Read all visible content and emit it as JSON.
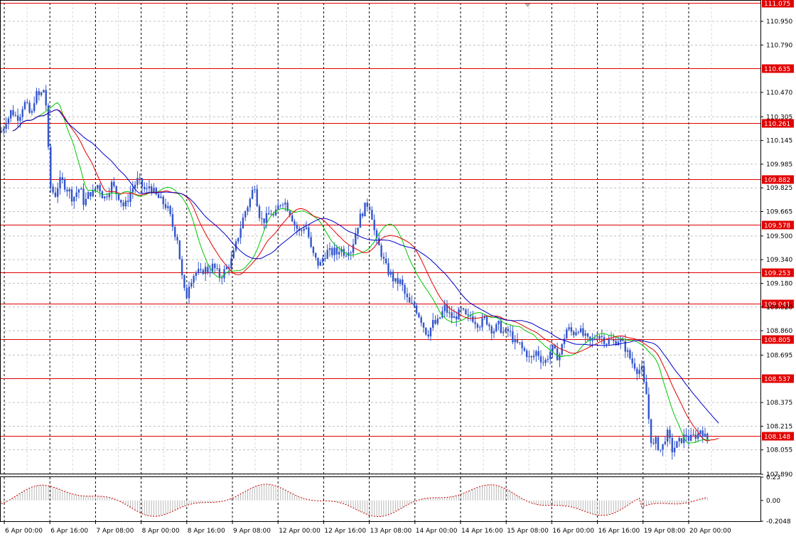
{
  "chart_data": {
    "type": "candlestick",
    "instrument_hint": "",
    "price_axis_ticks": [
      "110.950",
      "110.790",
      "110.470",
      "110.305",
      "110.145",
      "109.985",
      "109.825",
      "109.665",
      "109.500",
      "109.340",
      "109.180",
      "109.020",
      "108.860",
      "108.695",
      "108.375",
      "108.215",
      "108.055",
      "107.890"
    ],
    "price_ylim": [
      107.89,
      111.075
    ],
    "resistance_levels": [
      111.075,
      110.635,
      110.261,
      109.882,
      109.578,
      109.253,
      109.041,
      108.805,
      108.537,
      108.148
    ],
    "resistance_labels": [
      "111.075",
      "110.635",
      "110.261",
      "109.882",
      "109.578",
      "109.253",
      "109.041",
      "108.805",
      "108.537",
      "108.148"
    ],
    "time_axis_labels": [
      "6 Apr 00:00",
      "6 Apr 16:00",
      "7 Apr 08:00",
      "8 Apr 00:00",
      "8 Apr 16:00",
      "9 Apr 08:00",
      "12 Apr 00:00",
      "12 Apr 16:00",
      "13 Apr 08:00",
      "14 Apr 00:00",
      "14 Apr 16:00",
      "15 Apr 08:00",
      "16 Apr 00:00",
      "16 Apr 16:00",
      "19 Apr 08:00",
      "20 Apr 00:00"
    ],
    "price_path": [
      [
        0,
        110.2
      ],
      [
        4,
        110.22
      ],
      [
        8,
        110.28
      ],
      [
        12,
        110.3
      ],
      [
        16,
        110.35
      ],
      [
        20,
        110.32
      ],
      [
        24,
        110.3
      ],
      [
        28,
        110.32
      ],
      [
        32,
        110.38
      ],
      [
        36,
        110.4
      ],
      [
        40,
        110.35
      ],
      [
        44,
        110.3
      ],
      [
        48,
        110.42
      ],
      [
        52,
        110.46
      ],
      [
        56,
        110.44
      ],
      [
        60,
        110.48
      ],
      [
        63,
        110.5
      ],
      [
        66,
        110.3
      ],
      [
        70,
        109.85
      ],
      [
        74,
        109.8
      ],
      [
        78,
        109.78
      ],
      [
        82,
        109.85
      ],
      [
        86,
        109.88
      ],
      [
        90,
        109.85
      ],
      [
        94,
        109.82
      ],
      [
        98,
        109.8
      ],
      [
        102,
        109.75
      ],
      [
        106,
        109.78
      ],
      [
        110,
        109.82
      ],
      [
        114,
        109.8
      ],
      [
        118,
        109.72
      ],
      [
        122,
        109.75
      ],
      [
        126,
        109.8
      ],
      [
        130,
        109.78
      ],
      [
        134,
        109.82
      ],
      [
        138,
        109.85
      ],
      [
        142,
        109.8
      ],
      [
        146,
        109.75
      ],
      [
        150,
        109.78
      ],
      [
        154,
        109.82
      ],
      [
        158,
        109.86
      ],
      [
        162,
        109.8
      ],
      [
        166,
        109.78
      ],
      [
        170,
        109.74
      ],
      [
        174,
        109.7
      ],
      [
        178,
        109.72
      ],
      [
        182,
        109.78
      ],
      [
        186,
        109.82
      ],
      [
        190,
        109.85
      ],
      [
        194,
        109.88
      ],
      [
        198,
        109.85
      ],
      [
        202,
        109.82
      ],
      [
        206,
        109.8
      ],
      [
        210,
        109.84
      ],
      [
        214,
        109.82
      ],
      [
        218,
        109.78
      ],
      [
        222,
        109.76
      ],
      [
        226,
        109.74
      ],
      [
        230,
        109.72
      ],
      [
        234,
        109.7
      ],
      [
        238,
        109.66
      ],
      [
        242,
        109.58
      ],
      [
        246,
        109.52
      ],
      [
        250,
        109.48
      ],
      [
        254,
        109.3
      ],
      [
        258,
        109.15
      ],
      [
        262,
        109.08
      ],
      [
        266,
        109.18
      ],
      [
        270,
        109.22
      ],
      [
        274,
        109.25
      ],
      [
        278,
        109.26
      ],
      [
        282,
        109.24
      ],
      [
        286,
        109.27
      ],
      [
        290,
        109.28
      ],
      [
        294,
        109.26
      ],
      [
        298,
        109.3
      ],
      [
        302,
        109.28
      ],
      [
        306,
        109.25
      ],
      [
        310,
        109.22
      ],
      [
        314,
        109.25
      ],
      [
        318,
        109.28
      ],
      [
        322,
        109.3
      ],
      [
        326,
        109.34
      ],
      [
        330,
        109.4
      ],
      [
        334,
        109.48
      ],
      [
        338,
        109.55
      ],
      [
        342,
        109.62
      ],
      [
        346,
        109.68
      ],
      [
        350,
        109.72
      ],
      [
        354,
        109.78
      ],
      [
        358,
        109.86
      ],
      [
        362,
        109.72
      ],
      [
        366,
        109.62
      ],
      [
        370,
        109.6
      ],
      [
        374,
        109.62
      ],
      [
        378,
        109.64
      ],
      [
        382,
        109.66
      ],
      [
        386,
        109.62
      ],
      [
        390,
        109.68
      ],
      [
        394,
        109.72
      ],
      [
        398,
        109.74
      ],
      [
        402,
        109.72
      ],
      [
        406,
        109.68
      ],
      [
        410,
        109.64
      ],
      [
        414,
        109.58
      ],
      [
        418,
        109.55
      ],
      [
        422,
        109.52
      ],
      [
        426,
        109.55
      ],
      [
        430,
        109.58
      ],
      [
        434,
        109.5
      ],
      [
        438,
        109.4
      ],
      [
        442,
        109.36
      ],
      [
        446,
        109.32
      ],
      [
        450,
        109.3
      ],
      [
        454,
        109.35
      ],
      [
        458,
        109.38
      ],
      [
        462,
        109.4
      ],
      [
        466,
        109.38
      ],
      [
        470,
        109.4
      ],
      [
        474,
        109.38
      ],
      [
        478,
        109.42
      ],
      [
        482,
        109.4
      ],
      [
        486,
        109.38
      ],
      [
        490,
        109.42
      ],
      [
        494,
        109.4
      ],
      [
        498,
        109.48
      ],
      [
        502,
        109.55
      ],
      [
        506,
        109.62
      ],
      [
        510,
        109.66
      ],
      [
        514,
        109.7
      ],
      [
        518,
        109.72
      ],
      [
        522,
        109.68
      ],
      [
        526,
        109.55
      ],
      [
        530,
        109.46
      ],
      [
        534,
        109.42
      ],
      [
        538,
        109.36
      ],
      [
        542,
        109.3
      ],
      [
        546,
        109.26
      ],
      [
        550,
        109.24
      ],
      [
        554,
        109.2
      ],
      [
        558,
        109.18
      ],
      [
        562,
        109.2
      ],
      [
        566,
        109.16
      ],
      [
        570,
        109.1
      ],
      [
        574,
        109.06
      ],
      [
        578,
        109.02
      ],
      [
        582,
        109.04
      ],
      [
        586,
        109.0
      ],
      [
        590,
        108.96
      ],
      [
        594,
        108.92
      ],
      [
        598,
        108.86
      ],
      [
        602,
        108.84
      ],
      [
        606,
        108.88
      ],
      [
        610,
        108.92
      ],
      [
        614,
        108.9
      ],
      [
        618,
        108.94
      ],
      [
        622,
        108.98
      ],
      [
        626,
        109.02
      ],
      [
        630,
        108.98
      ],
      [
        634,
        108.96
      ],
      [
        638,
        108.94
      ],
      [
        642,
        108.96
      ],
      [
        646,
        108.98
      ],
      [
        650,
        109.0
      ],
      [
        654,
        108.96
      ],
      [
        658,
        108.94
      ],
      [
        662,
        108.96
      ],
      [
        666,
        108.94
      ],
      [
        670,
        108.92
      ],
      [
        674,
        108.9
      ],
      [
        678,
        108.92
      ],
      [
        682,
        108.94
      ],
      [
        686,
        108.92
      ],
      [
        690,
        108.88
      ],
      [
        694,
        108.86
      ],
      [
        698,
        108.88
      ],
      [
        702,
        108.9
      ],
      [
        706,
        108.86
      ],
      [
        710,
        108.84
      ],
      [
        714,
        108.86
      ],
      [
        718,
        108.84
      ],
      [
        722,
        108.8
      ],
      [
        726,
        108.76
      ],
      [
        730,
        108.78
      ],
      [
        734,
        108.74
      ],
      [
        738,
        108.72
      ],
      [
        742,
        108.7
      ],
      [
        746,
        108.66
      ],
      [
        750,
        108.68
      ],
      [
        754,
        108.72
      ],
      [
        758,
        108.7
      ],
      [
        762,
        108.66
      ],
      [
        766,
        108.64
      ],
      [
        770,
        108.68
      ],
      [
        774,
        108.72
      ],
      [
        778,
        108.74
      ],
      [
        782,
        108.7
      ],
      [
        786,
        108.68
      ],
      [
        790,
        108.74
      ],
      [
        794,
        108.82
      ],
      [
        798,
        108.88
      ],
      [
        802,
        108.86
      ],
      [
        806,
        108.84
      ],
      [
        810,
        108.86
      ],
      [
        814,
        108.88
      ],
      [
        818,
        108.84
      ],
      [
        822,
        108.82
      ],
      [
        826,
        108.8
      ],
      [
        830,
        108.78
      ],
      [
        834,
        108.8
      ],
      [
        838,
        108.82
      ],
      [
        842,
        108.84
      ],
      [
        846,
        108.82
      ],
      [
        850,
        108.8
      ],
      [
        854,
        108.78
      ],
      [
        858,
        108.8
      ],
      [
        862,
        108.78
      ],
      [
        866,
        108.79
      ],
      [
        870,
        108.8
      ],
      [
        874,
        108.78
      ],
      [
        878,
        108.76
      ],
      [
        882,
        108.72
      ],
      [
        886,
        108.68
      ],
      [
        890,
        108.64
      ],
      [
        894,
        108.62
      ],
      [
        898,
        108.58
      ],
      [
        902,
        108.62
      ],
      [
        906,
        108.5
      ],
      [
        910,
        108.42
      ],
      [
        914,
        108.2
      ],
      [
        918,
        108.06
      ],
      [
        922,
        108.12
      ],
      [
        926,
        108.08
      ],
      [
        930,
        108.05
      ],
      [
        934,
        108.1
      ],
      [
        938,
        108.18
      ],
      [
        942,
        108.12
      ],
      [
        946,
        108.05
      ],
      [
        950,
        108.08
      ],
      [
        954,
        108.1
      ],
      [
        958,
        108.12
      ],
      [
        962,
        108.14
      ],
      [
        966,
        108.16
      ],
      [
        970,
        108.12
      ],
      [
        974,
        108.14
      ],
      [
        978,
        108.15
      ],
      [
        982,
        108.16
      ],
      [
        986,
        108.2
      ],
      [
        990,
        108.16
      ],
      [
        994,
        108.12
      ],
      [
        997,
        108.14
      ]
    ],
    "ma_fast_color": "#00c800",
    "ma_mid_color": "#e00000",
    "ma_slow_color": "#0000c8",
    "candle_color": "#3355cc",
    "level_color": "#e00000",
    "oscillator_axis_ticks": [
      "0.23",
      "0.00",
      "-0.2048"
    ],
    "oscillator_ylim": [
      -0.2048,
      0.23
    ],
    "oscillator_color": "#cc0000",
    "grid": true
  }
}
